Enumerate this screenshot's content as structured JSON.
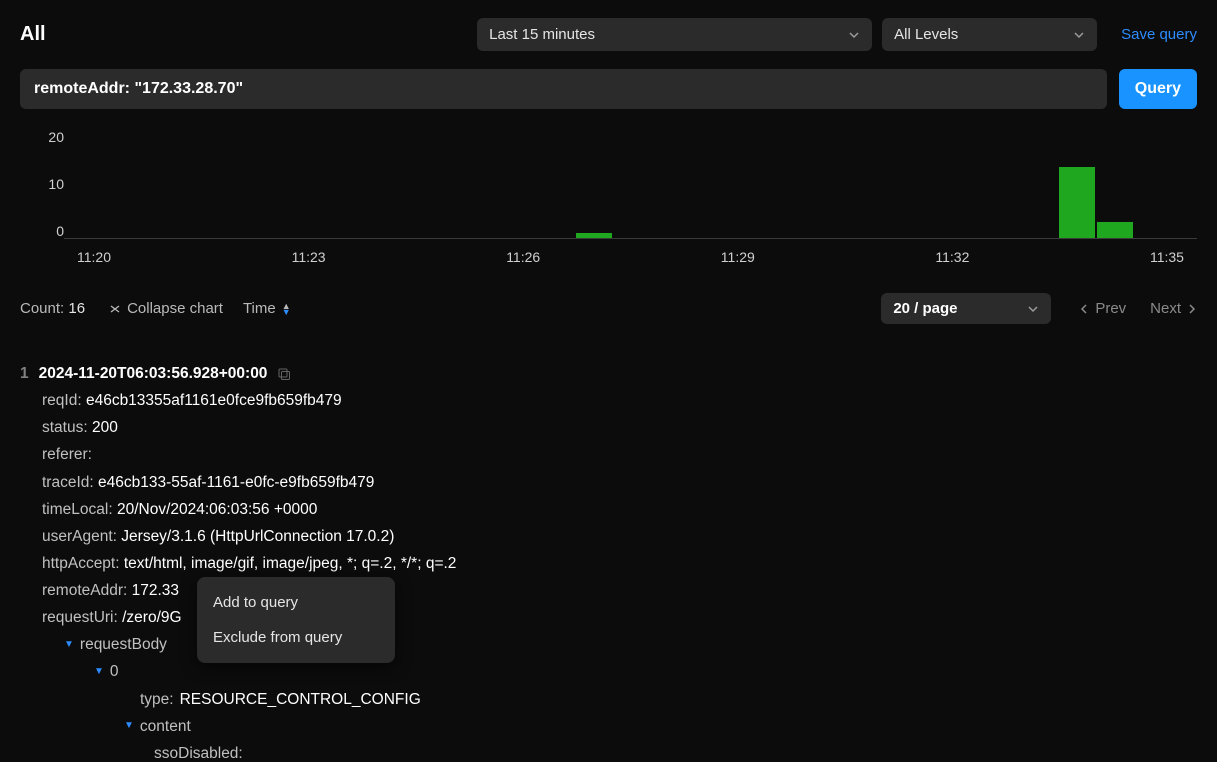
{
  "header": {
    "title": "All",
    "time_range": "Last 15 minutes",
    "level": "All Levels",
    "save_query": "Save query"
  },
  "search": {
    "value": "remoteAddr: \"172.33.28.70\"",
    "query_btn": "Query"
  },
  "chart_data": {
    "type": "bar",
    "x_ticks": [
      "11:20",
      "11:23",
      "11:26",
      "11:29",
      "11:32",
      "11:35"
    ],
    "y_ticks": [
      "20",
      "10",
      "0"
    ],
    "ylim": [
      0,
      20
    ],
    "bars": [
      {
        "time": "11:26",
        "value": 1,
        "left_pct": 45.2
      },
      {
        "time": "11:33",
        "value": 13,
        "left_pct": 87.8
      },
      {
        "time": "11:34",
        "value": 3,
        "left_pct": 91.2
      }
    ]
  },
  "meta": {
    "count_label": "Count:",
    "count_value": "16",
    "collapse": "Collapse chart",
    "time_sort": "Time",
    "per_page": "20 / page",
    "prev": "Prev",
    "next": "Next"
  },
  "context_menu": {
    "add": "Add to query",
    "exclude": "Exclude from query"
  },
  "log": {
    "index": "1",
    "timestamp": "2024-11-20T06:03:56.928+00:00",
    "fields": {
      "reqId": {
        "k": "reqId:",
        "v": "e46cb13355af1161e0fce9fb659fb479"
      },
      "status": {
        "k": "status:",
        "v": "200"
      },
      "referer": {
        "k": "referer:",
        "v": ""
      },
      "traceId": {
        "k": "traceId:",
        "v": "e46cb133-55af-1161-e0fc-e9fb659fb479"
      },
      "timeLocal": {
        "k": "timeLocal:",
        "v": "20/Nov/2024:06:03:56 +0000"
      },
      "userAgent": {
        "k": "userAgent:",
        "v": "Jersey/3.1.6 (HttpUrlConnection 17.0.2)"
      },
      "httpAccept": {
        "k": "httpAccept:",
        "v": "text/html, image/gif, image/jpeg, *; q=.2, */*; q=.2"
      },
      "remoteAddr": {
        "k": "remoteAddr:",
        "v": "172.33"
      },
      "requestUri": {
        "k": "requestUri:",
        "v": "/zero/9G"
      },
      "requestBody": {
        "k": "requestBody"
      },
      "zero": {
        "k": "0"
      },
      "type": {
        "k": "type:",
        "v": "RESOURCE_CONTROL_CONFIG"
      },
      "content": {
        "k": "content"
      },
      "ssoDisabled": {
        "k": "ssoDisabled:"
      }
    }
  }
}
